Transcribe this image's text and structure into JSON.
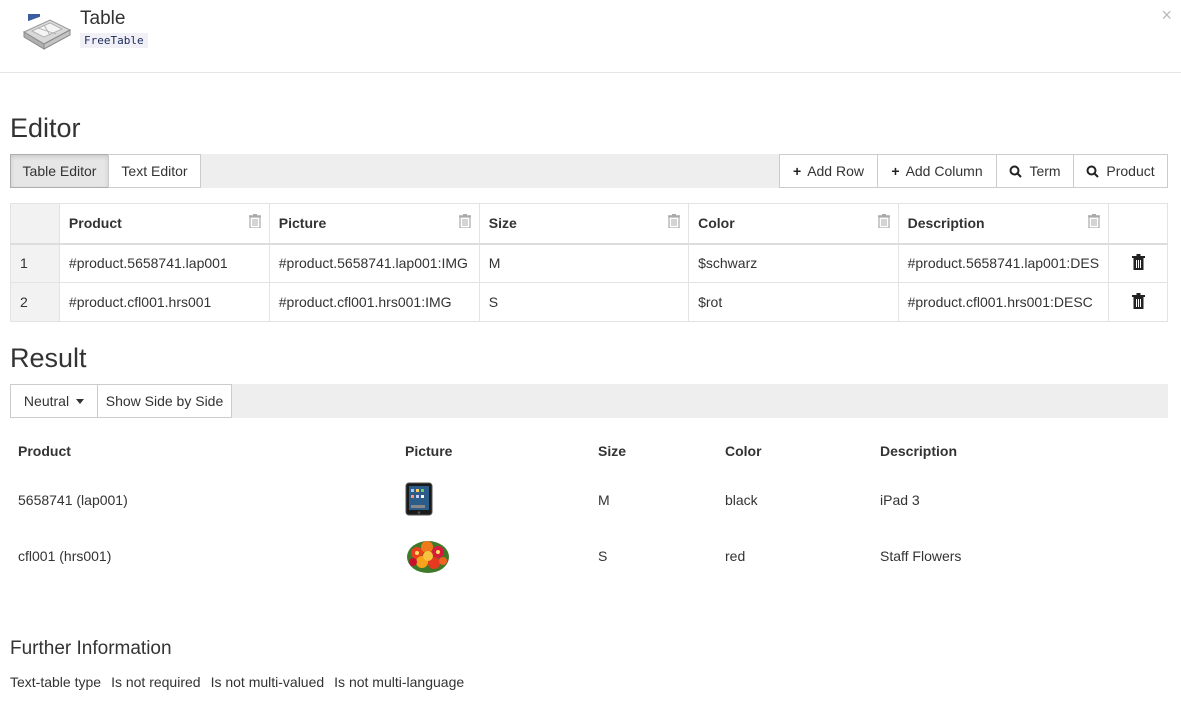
{
  "header": {
    "title": "Table",
    "code": "FreeTable",
    "close": "×"
  },
  "editor": {
    "heading": "Editor",
    "tabs": [
      "Table Editor",
      "Text Editor"
    ],
    "actions": [
      {
        "icon": "plus-icon",
        "glyph": "+",
        "label": "Add Row"
      },
      {
        "icon": "plus-icon",
        "glyph": "+",
        "label": "Add Column"
      },
      {
        "icon": "search-icon",
        "glyph": "⚲",
        "label": "Term"
      },
      {
        "icon": "search-icon",
        "glyph": "⚲",
        "label": "Product"
      }
    ],
    "columns": [
      "Product",
      "Picture",
      "Size",
      "Color",
      "Description"
    ],
    "rows": [
      {
        "num": "1",
        "cells": [
          "#product.5658741.lap001",
          "#product.5658741.lap001:IMG",
          "M",
          "$schwarz",
          "#product.5658741.lap001:DES"
        ]
      },
      {
        "num": "2",
        "cells": [
          "#product.cfl001.hrs001",
          "#product.cfl001.hrs001:IMG",
          "S",
          "$rot",
          "#product.cfl001.hrs001:DESC"
        ]
      }
    ]
  },
  "result": {
    "heading": "Result",
    "view_select": "Neutral",
    "side_by_side": "Show Side by Side",
    "columns": [
      "Product",
      "Picture",
      "Size",
      "Color",
      "Description"
    ],
    "rows": [
      {
        "product": "5658741 (lap001)",
        "picture_icon": "ipad-image",
        "size": "M",
        "color": "black",
        "description": "iPad 3"
      },
      {
        "product": "cfl001 (hrs001)",
        "picture_icon": "flowers-image",
        "size": "S",
        "color": "red",
        "description": "Staff Flowers"
      }
    ]
  },
  "further": {
    "heading": "Further Information",
    "tags": [
      "Text-table type",
      "Is not required",
      "Is not multi-valued",
      "Is not multi-language"
    ]
  }
}
